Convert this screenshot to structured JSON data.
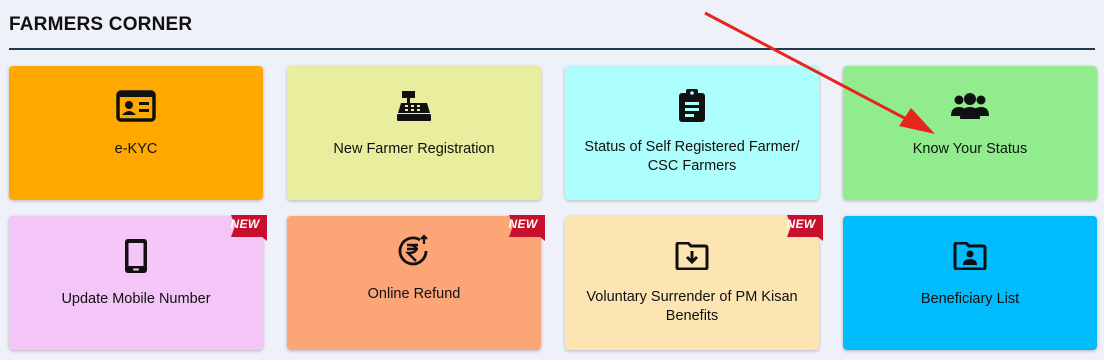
{
  "section": {
    "title": "FARMERS CORNER"
  },
  "badge_text": "NEW",
  "tiles": [
    {
      "label": "e-KYC",
      "icon": "id-card-icon",
      "color": "#ffa800"
    },
    {
      "label": "New Farmer Registration",
      "icon": "cash-register-icon",
      "color": "#e8ee9e"
    },
    {
      "label_line1": "Status of Self Registered Farmer/",
      "label_line2": "CSC Farmers",
      "icon": "clipboard-list-icon",
      "color": "#adfffe"
    },
    {
      "label": "Know Your Status",
      "icon": "users-icon",
      "color": "#90ec8c"
    },
    {
      "label": "Update Mobile Number",
      "icon": "mobile-phone-icon",
      "color": "#f4c6f8",
      "new": true
    },
    {
      "label": "Online Refund",
      "icon": "rupee-refund-icon",
      "color": "#fca577",
      "new": true
    },
    {
      "label_line1": "Voluntary Surrender of PM Kisan",
      "label_line2": "Benefits",
      "icon": "folder-download-icon",
      "color": "#fde5b3",
      "new": true
    },
    {
      "label": "Beneficiary List",
      "icon": "folder-user-icon",
      "color": "#00bcfc"
    }
  ],
  "colors": {
    "badge": "#c8102e",
    "rule": "#1f3b57",
    "annotation_arrow": "#e8251d"
  }
}
